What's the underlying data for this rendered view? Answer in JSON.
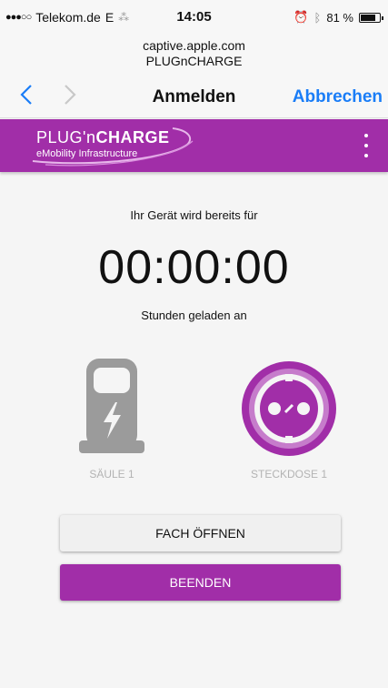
{
  "status_bar": {
    "carrier": "Telekom.de",
    "network": "E",
    "time": "14:05",
    "battery_percent": "81 %",
    "battery_level": 0.81
  },
  "url_bar": {
    "domain": "captive.apple.com",
    "page_title": "PLUGnCHARGE"
  },
  "nav": {
    "back_icon": "chevron-left-icon",
    "forward_icon": "chevron-right-icon",
    "title": "Anmelden",
    "cancel_label": "Abbrechen"
  },
  "app_bar": {
    "logo_prefix": "PLUG'n",
    "logo_bold": "CHARGE",
    "logo_subtitle": "eMobility Infrastructure",
    "menu_icon": "more-vertical-icon"
  },
  "main": {
    "intro_text": "Ihr Gerät wird bereits für",
    "timer": "00:00:00",
    "outro_text": "Stunden geladen an",
    "station_label": "SÄULE 1",
    "socket_label": "STECKDOSE 1",
    "open_button": "FACH ÖFFNEN",
    "end_button": "BEENDEN"
  },
  "colors": {
    "brand": "#a12ea8",
    "link": "#1a7df7",
    "inactive": "#b3b3b3"
  }
}
